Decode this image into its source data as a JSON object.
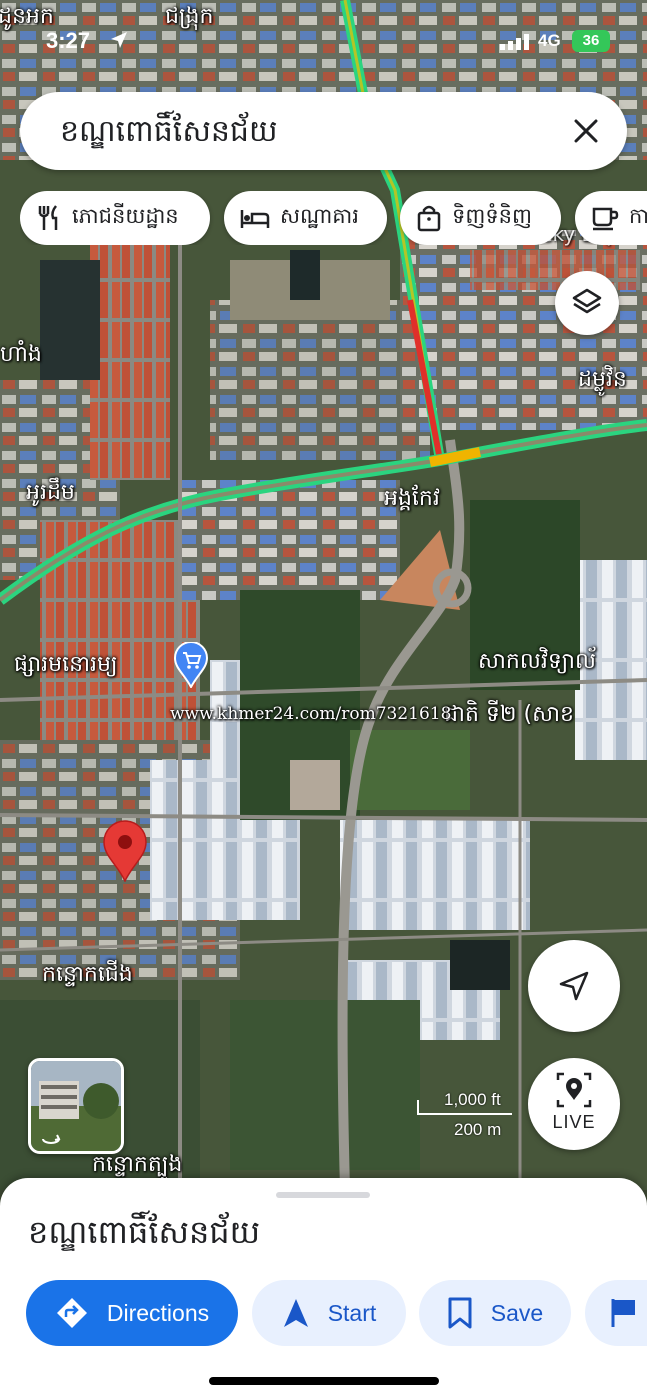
{
  "status_bar": {
    "time": "3:27",
    "network": "4G",
    "battery": "36"
  },
  "search": {
    "query": "ខណ្ឌពោធិ៍សែនជ័យ"
  },
  "chips": [
    {
      "label": "ភោជនីយដ្ឋាន",
      "icon": "restaurant-icon"
    },
    {
      "label": "សណ្ឋាគារ",
      "icon": "hotel-icon"
    },
    {
      "label": "ទិញទំនិញ",
      "icon": "shopping-icon"
    },
    {
      "label": "កា",
      "icon": "coffee-icon"
    }
  ],
  "map": {
    "labels": {
      "top_left": "ដូនអក",
      "top_center": "ជង្រុក",
      "left_mid": "ហាំង",
      "right_mid": "ដម្លូវិន",
      "left_road": "អូរដឹម",
      "center_road": "អង្គកែវ",
      "market": "ផ្សារមនោរម្យ",
      "university_1": "សាកលវិទ្យាល័",
      "university_2": "ជាតិ ទី២ (សាខ",
      "watermark": "www.khmer24.com/rom7321618",
      "south_1": "កន្ទោកជើង",
      "south_2": "កន្ទោកត្បូង",
      "top_right_business": "Lucky Exp"
    },
    "scale_ft": "1,000 ft",
    "scale_m": "200 m",
    "live_label": "LIVE"
  },
  "sheet": {
    "title": "ខណ្ឌពោធិ៍សែនជ័យ",
    "actions": [
      {
        "label": "Directions",
        "icon": "directions-icon"
      },
      {
        "label": "Start",
        "icon": "navigation-icon"
      },
      {
        "label": "Save",
        "icon": "bookmark-icon"
      }
    ]
  },
  "colors": {
    "primary": "#1a73e8",
    "secondary_bg": "#e8f0fe",
    "route_green": "#2bd47f",
    "pin_red": "#e53935"
  }
}
